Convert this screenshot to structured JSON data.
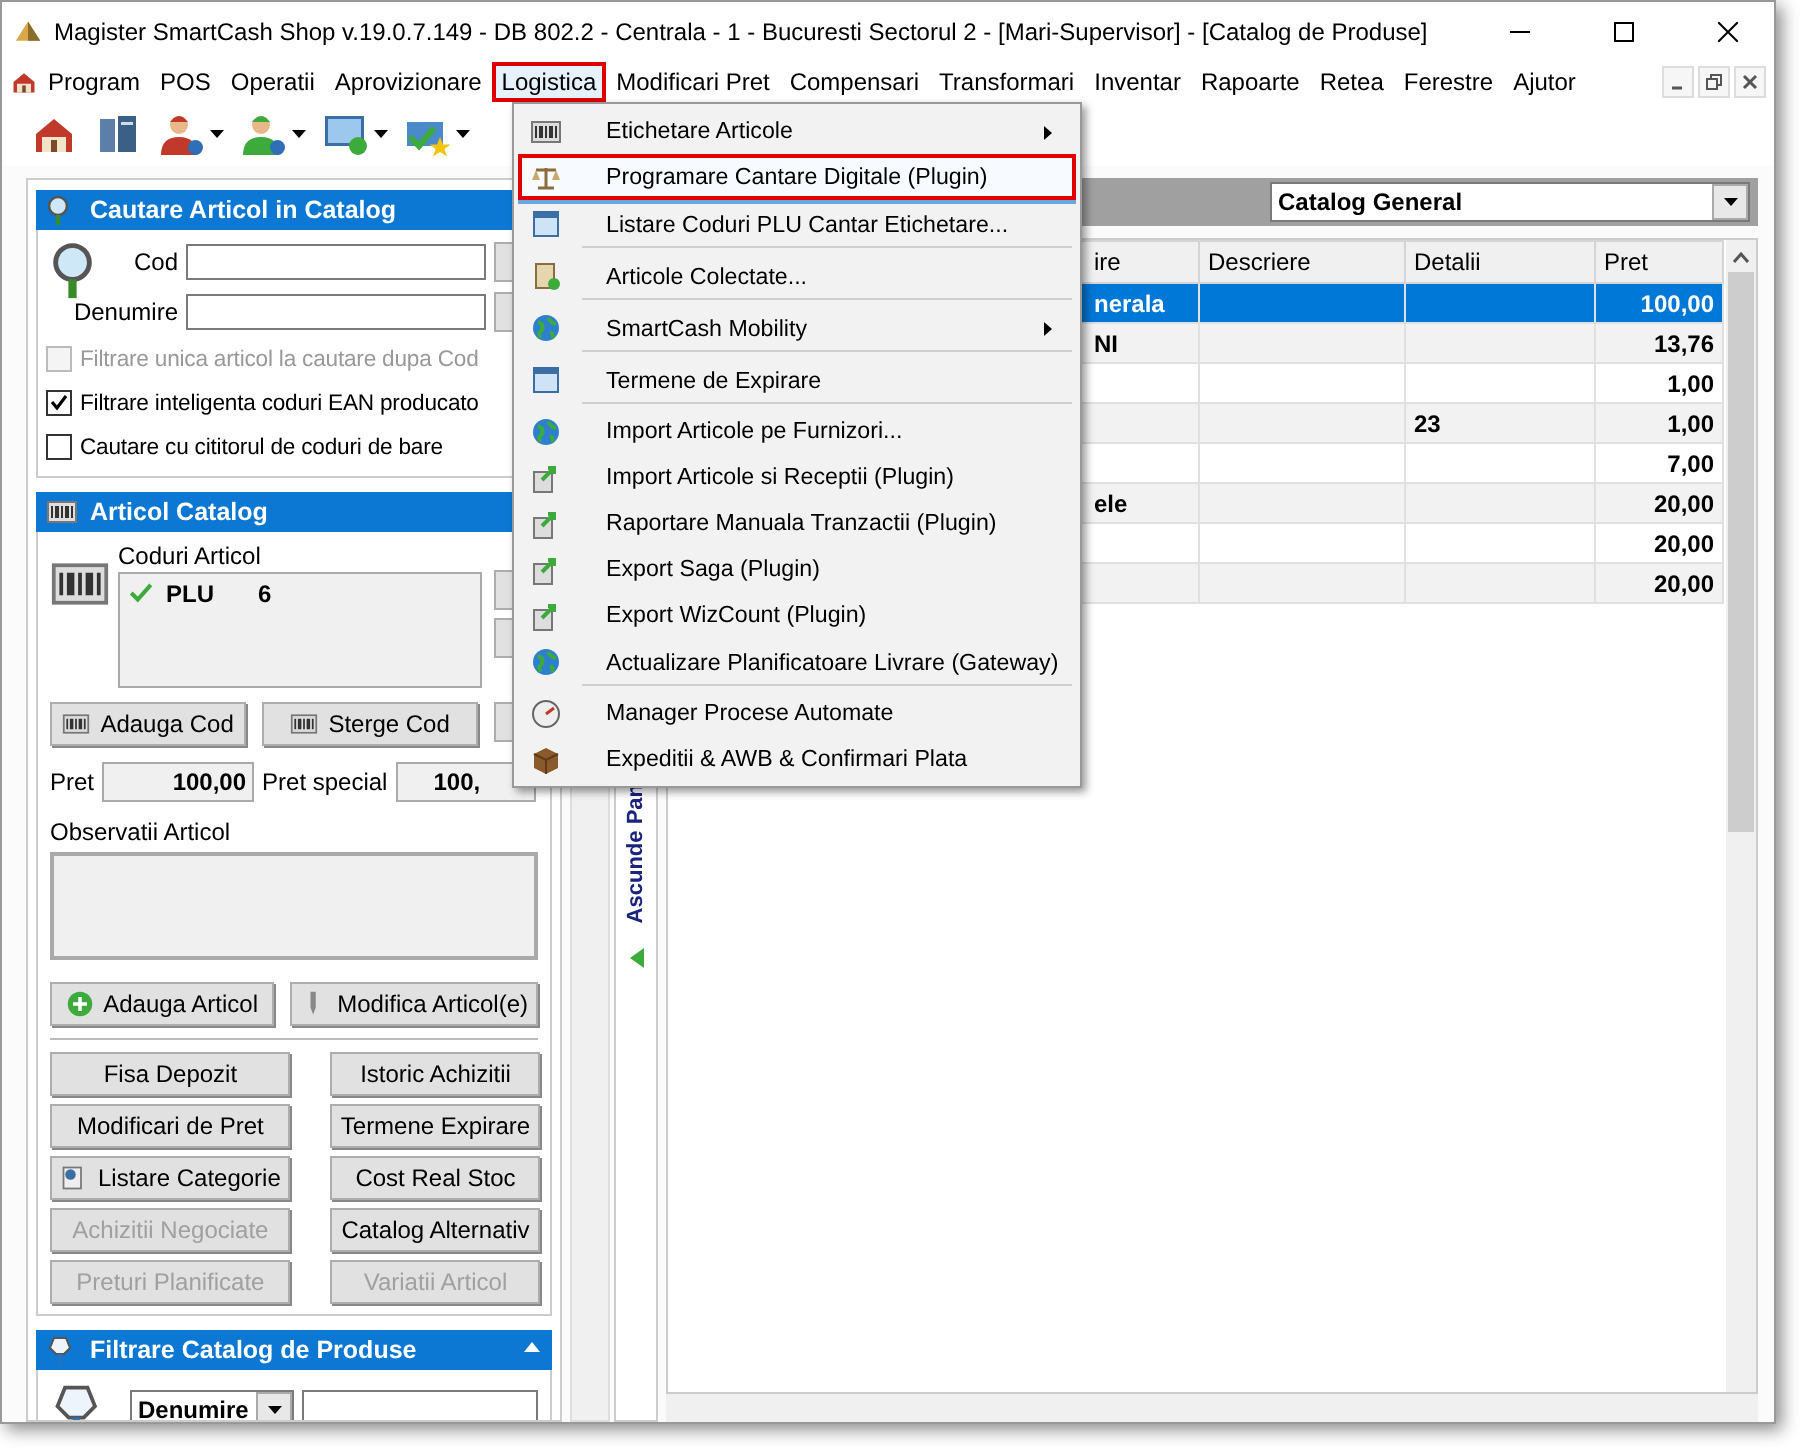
{
  "window": {
    "title": "Magister SmartCash Shop v.19.0.7.149 - DB 802.2 - Centrala - 1 - Bucuresti Sectorul 2 - [Mari-Supervisor] - [Catalog de Produse]"
  },
  "menu_bar": [
    {
      "label": "Program",
      "selected": false
    },
    {
      "label": "POS",
      "selected": false
    },
    {
      "label": "Operatii",
      "selected": false
    },
    {
      "label": "Aprovizionare",
      "selected": false
    },
    {
      "label": "Logistica",
      "selected": true
    },
    {
      "label": "Modificari Pret",
      "selected": false
    },
    {
      "label": "Compensari",
      "selected": false
    },
    {
      "label": "Transformari",
      "selected": false
    },
    {
      "label": "Inventar",
      "selected": false
    },
    {
      "label": "Rapoarte",
      "selected": false
    },
    {
      "label": "Retea",
      "selected": false
    },
    {
      "label": "Ferestre",
      "selected": false
    },
    {
      "label": "Ajutor",
      "selected": false
    }
  ],
  "logistica_menu": [
    {
      "label": "Etichetare Articole",
      "submenu": true,
      "selected": false,
      "separator_after": false
    },
    {
      "label": "Programare Cantare Digitale (Plugin)",
      "submenu": false,
      "selected": true,
      "separator_after": false
    },
    {
      "label": "Listare Coduri PLU Cantar Etichetare...",
      "submenu": false,
      "selected": false,
      "separator_after": true
    },
    {
      "label": "Articole Colectate...",
      "submenu": false,
      "selected": false,
      "separator_after": true
    },
    {
      "label": "SmartCash Mobility",
      "submenu": true,
      "selected": false,
      "separator_after": true
    },
    {
      "label": "Termene de Expirare",
      "submenu": false,
      "selected": false,
      "separator_after": true
    },
    {
      "label": "Import Articole pe Furnizori...",
      "submenu": false,
      "selected": false,
      "separator_after": false
    },
    {
      "label": "Import Articole si Receptii (Plugin)",
      "submenu": false,
      "selected": false,
      "separator_after": false
    },
    {
      "label": "Raportare Manuala Tranzactii (Plugin)",
      "submenu": false,
      "selected": false,
      "separator_after": false
    },
    {
      "label": "Export Saga (Plugin)",
      "submenu": false,
      "selected": false,
      "separator_after": false
    },
    {
      "label": "Export WizCount (Plugin)",
      "submenu": false,
      "selected": false,
      "separator_after": false
    },
    {
      "label": "Actualizare Planificatoare Livrare (Gateway)",
      "submenu": false,
      "selected": false,
      "separator_after": true
    },
    {
      "label": "Manager Procese Automate",
      "submenu": false,
      "selected": false,
      "separator_after": false
    },
    {
      "label": "Expeditii & AWB & Confirmari Plata",
      "submenu": false,
      "selected": false,
      "separator_after": false
    }
  ],
  "search_panel": {
    "title": "Cautare Articol in Catalog",
    "fields": [
      {
        "label": "Cod"
      },
      {
        "label": "Denumire"
      }
    ],
    "options": [
      {
        "label": "Filtrare unica articol la cautare dupa Cod",
        "checked": false,
        "disabled": true
      },
      {
        "label": "Filtrare inteligenta coduri EAN producato",
        "checked": true,
        "disabled": false
      },
      {
        "label": "Cautare cu cititorul de coduri de bare",
        "checked": false,
        "disabled": false
      }
    ]
  },
  "article_panel": {
    "title": "Articol Catalog",
    "codes_label": "Coduri Articol",
    "codes": [
      {
        "type": "PLU",
        "value": "6"
      }
    ],
    "code_buttons": [
      {
        "label": "Adauga Cod",
        "kind": "add"
      },
      {
        "label": "Sterge Cod",
        "kind": "delete"
      }
    ],
    "price_label": "Pret",
    "price": "100,00",
    "special_price_label": "Pret special",
    "special_price": "100,",
    "notes_label": "Observatii Articol",
    "main_buttons": [
      {
        "label": "Adauga Articol",
        "kind": "add"
      },
      {
        "label": "Modifica Articol(e)",
        "kind": "edit"
      }
    ],
    "buttons": [
      {
        "label": "Fisa Depozit",
        "kind": "plain",
        "disabled": false
      },
      {
        "label": "Istoric Achizitii",
        "kind": "plain",
        "disabled": false
      },
      {
        "label": "Modificari de Pret",
        "kind": "plain",
        "disabled": false
      },
      {
        "label": "Termene Expirare",
        "kind": "plain",
        "disabled": false
      },
      {
        "label": "Listare Categorie",
        "kind": "icon",
        "disabled": false
      },
      {
        "label": "Cost Real Stoc",
        "kind": "plain",
        "disabled": false
      },
      {
        "label": "Achizitii Negociate",
        "kind": "plain",
        "disabled": true
      },
      {
        "label": "Catalog Alternativ",
        "kind": "plain",
        "disabled": false
      },
      {
        "label": "Preturi Planificate",
        "kind": "plain",
        "disabled": true
      },
      {
        "label": "Variatii Articol",
        "kind": "plain",
        "disabled": true
      }
    ]
  },
  "filter_panel": {
    "title": "Filtrare Catalog de Produse",
    "field": "Denumire"
  },
  "side_strip": {
    "label": "Ascunde Pan"
  },
  "catalog": {
    "selector": "Catalog General",
    "columns": {
      "column_1": "ire",
      "description": "Descriere",
      "details": "Detalii",
      "price": "Pret"
    },
    "rows": [
      {
        "column_1": "nerala",
        "price": "100,00",
        "selected": true
      },
      {
        "column_1": "NI",
        "price": "13,76",
        "selected": false
      },
      {
        "price": "1,00",
        "selected": false
      },
      {
        "details": "23",
        "price": "1,00",
        "selected": false
      },
      {
        "price": "7,00",
        "selected": false
      },
      {
        "column_1": "ele",
        "price": "20,00",
        "selected": false
      },
      {
        "price": "20,00",
        "selected": false
      },
      {
        "price": "20,00",
        "selected": false
      }
    ]
  }
}
